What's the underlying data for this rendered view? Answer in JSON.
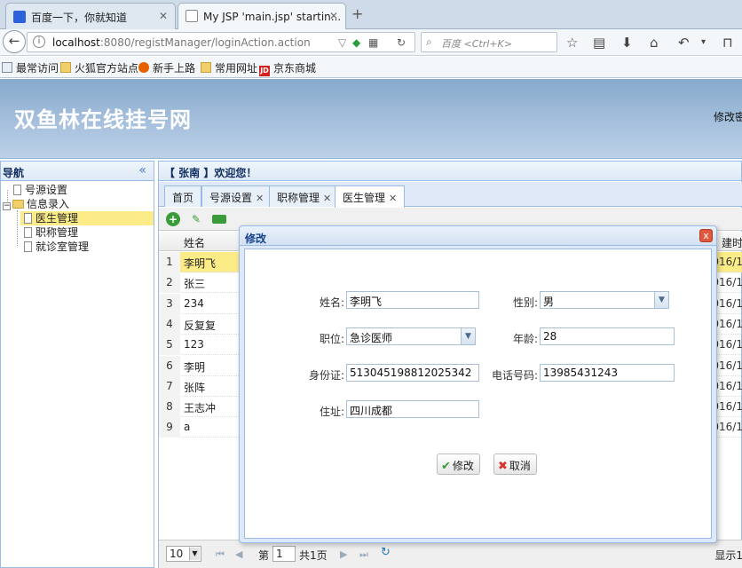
{
  "browser": {
    "tabs": [
      {
        "title": "百度一下，你就知道",
        "active": false
      },
      {
        "title": "My JSP 'main.jsp' startin...",
        "active": true
      }
    ],
    "url_host": "localhost",
    "url_rest": ":8080/registManager/loginAction.action",
    "search_placeholder": "百度 <Ctrl+K>",
    "bookmarks": [
      "最常访问",
      "火狐官方站点",
      "新手上路",
      "常用网址",
      "京东商城"
    ]
  },
  "header": {
    "title": "双鱼林在线挂号网",
    "right_link": "修改密"
  },
  "nav": {
    "title": "导航",
    "items": [
      "号源设置",
      "信息录入",
      "医生管理",
      "职称管理",
      "就诊室管理"
    ]
  },
  "main": {
    "welcome": "【 张南 】欢迎您！",
    "tabs": [
      {
        "label": "首页",
        "closable": false
      },
      {
        "label": "号源设置",
        "closable": true
      },
      {
        "label": "职称管理",
        "closable": true
      },
      {
        "label": "医生管理",
        "closable": true
      }
    ],
    "grid": {
      "col_name": "姓名",
      "col_time": "建时",
      "rows": [
        {
          "num": "1",
          "name": "李明飞",
          "date": "016/1"
        },
        {
          "num": "2",
          "name": "张三",
          "date": "016/1"
        },
        {
          "num": "3",
          "name": "234",
          "date": "016/1"
        },
        {
          "num": "4",
          "name": "反复复",
          "date": "016/1"
        },
        {
          "num": "5",
          "name": "123",
          "date": "016/1"
        },
        {
          "num": "6",
          "name": "李明",
          "date": "016/1"
        },
        {
          "num": "7",
          "name": "张阵",
          "date": "016/1"
        },
        {
          "num": "8",
          "name": "王志冲",
          "date": "016/1"
        },
        {
          "num": "9",
          "name": "a",
          "date": "016/1"
        }
      ]
    },
    "pager": {
      "page_size": "10",
      "page_prefix": "第",
      "page": "1",
      "page_total": "共1页",
      "display": "显示1"
    }
  },
  "modal": {
    "title": "修改",
    "close": "x",
    "fields": {
      "name_label": "姓名:",
      "name_value": "李明飞",
      "gender_label": "性别:",
      "gender_value": "男",
      "position_label": "职位:",
      "position_value": "急诊医师",
      "age_label": "年龄:",
      "age_value": "28",
      "idcard_label": "身份证:",
      "idcard_value": "513045198812025342",
      "phone_label": "电话号码:",
      "phone_value": "13985431243",
      "address_label": "住址:",
      "address_value": "四川成都"
    },
    "save_label": "修改",
    "cancel_label": "取消"
  },
  "colors": {
    "header_gradient_top": "#87a9cc",
    "selection": "#fbec88",
    "panel_border": "#99bbe8"
  }
}
